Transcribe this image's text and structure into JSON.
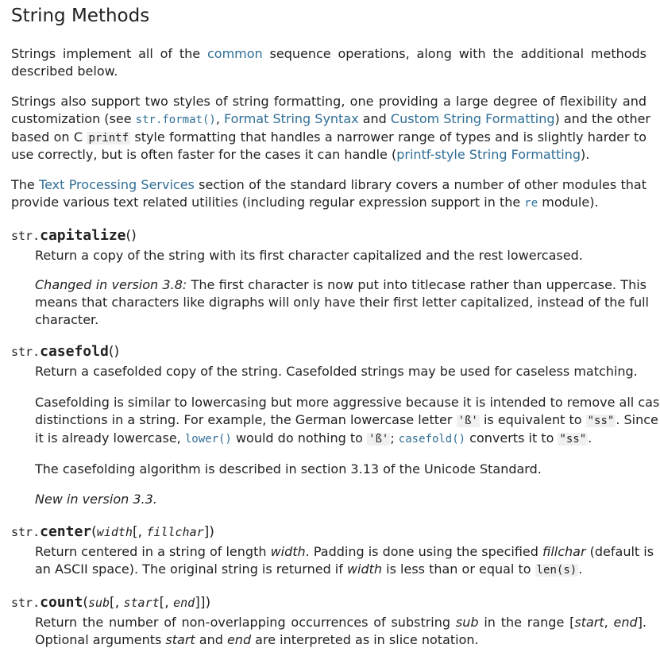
{
  "page": {
    "title": "String Methods"
  },
  "intro": {
    "p1": {
      "before": "Strings implement all of the",
      "link": "common",
      "after": "sequence operations, along with the additional methods",
      "line2": "described below."
    },
    "p2": {
      "l1": "Strings also support two styles of string formatting, one providing a large degree of flexibility and",
      "l2_a": "customization (see ",
      "l2_code": "str.format()",
      "l2_b": ", ",
      "l2_link1": "Format String Syntax",
      "l2_c": " and ",
      "l2_link2": "Custom String Formatting",
      "l2_d": ") and the other",
      "l3_a": "based on C ",
      "l3_code": "printf",
      "l3_b": " style formatting that handles a narrower range of types and is slightly harder to",
      "l4_a": "use correctly, but is often faster for the cases it can handle (",
      "l4_link": "printf-style String Formatting",
      "l4_b": ")."
    },
    "p3": {
      "l1_a": "The ",
      "l1_link": "Text Processing Services",
      "l1_b": " section of the standard library covers a number of other modules that",
      "l2_a": "provide various text related utilities (including regular expression support in the ",
      "l2_code": "re",
      "l2_b": " module)."
    }
  },
  "methods": {
    "capitalize": {
      "prefix": "str.",
      "name": "capitalize",
      "params": "()",
      "desc": "Return a copy of the string with its first character capitalized and the rest lowercased.",
      "changed_label": "Changed in version 3.8:",
      "changed_l1": " The first character is now put into titlecase rather than uppercase. This",
      "changed_l2": "means that characters like digraphs will only have their first letter capitalized, instead of the full",
      "changed_l3": "character."
    },
    "casefold": {
      "prefix": "str.",
      "name": "casefold",
      "params": "()",
      "desc": "Return a casefolded copy of the string. Casefolded strings may be used for caseless matching.",
      "p2_l1": "Casefolding is similar to lowercasing but more aggressive because it is intended to remove all case",
      "p2_l2_a": "distinctions in a string. For example, the German lowercase letter ",
      "p2_l2_code1": "'ß'",
      "p2_l2_b": " is equivalent to ",
      "p2_l2_code2": "\"ss\"",
      "p2_l2_c": ". Since",
      "p2_l3_a": "it is already lowercase, ",
      "p2_l3_code1": "lower()",
      "p2_l3_b": " would do nothing to ",
      "p2_l3_code2": "'ß'",
      "p2_l3_c": "; ",
      "p2_l3_code3": "casefold()",
      "p2_l3_d": " converts it to ",
      "p2_l3_code4": "\"ss\"",
      "p2_l3_e": ".",
      "p3": "The casefolding algorithm is described in section 3.13 of the Unicode Standard.",
      "new": "New in version 3.3."
    },
    "center": {
      "prefix": "str.",
      "name": "center",
      "open": "(",
      "param1": "width",
      "bracket_open": "[",
      "comma": ", ",
      "param2": "fillchar",
      "bracket_close": "]",
      "close": ")",
      "l1_a": "Return centered in a string of length ",
      "l1_width": "width",
      "l1_b": ". Padding is done using the specified ",
      "l1_fill": "fillchar",
      "l1_c": " (default is",
      "l2_a": "an ASCII space). The original string is returned if ",
      "l2_width": "width",
      "l2_b": " is less than or equal to ",
      "l2_code": "len(s)",
      "l2_c": "."
    },
    "count": {
      "prefix": "str.",
      "name": "count",
      "open": "(",
      "param1": "sub",
      "b1": "[",
      "comma1": ", ",
      "param2": "start",
      "b2": "[",
      "comma2": ", ",
      "param3": "end",
      "b3": "]]",
      "close": ")",
      "l1_a": "Return the number of non-overlapping occurrences of substring ",
      "l1_sub": "sub",
      "l1_b": " in the range [",
      "l1_start": "start",
      "l1_c": ", ",
      "l1_end": "end",
      "l1_d": "].",
      "l2_a": "Optional arguments ",
      "l2_start": "start",
      "l2_b": " and ",
      "l2_end": "end",
      "l2_c": " are interpreted as in slice notation."
    }
  }
}
